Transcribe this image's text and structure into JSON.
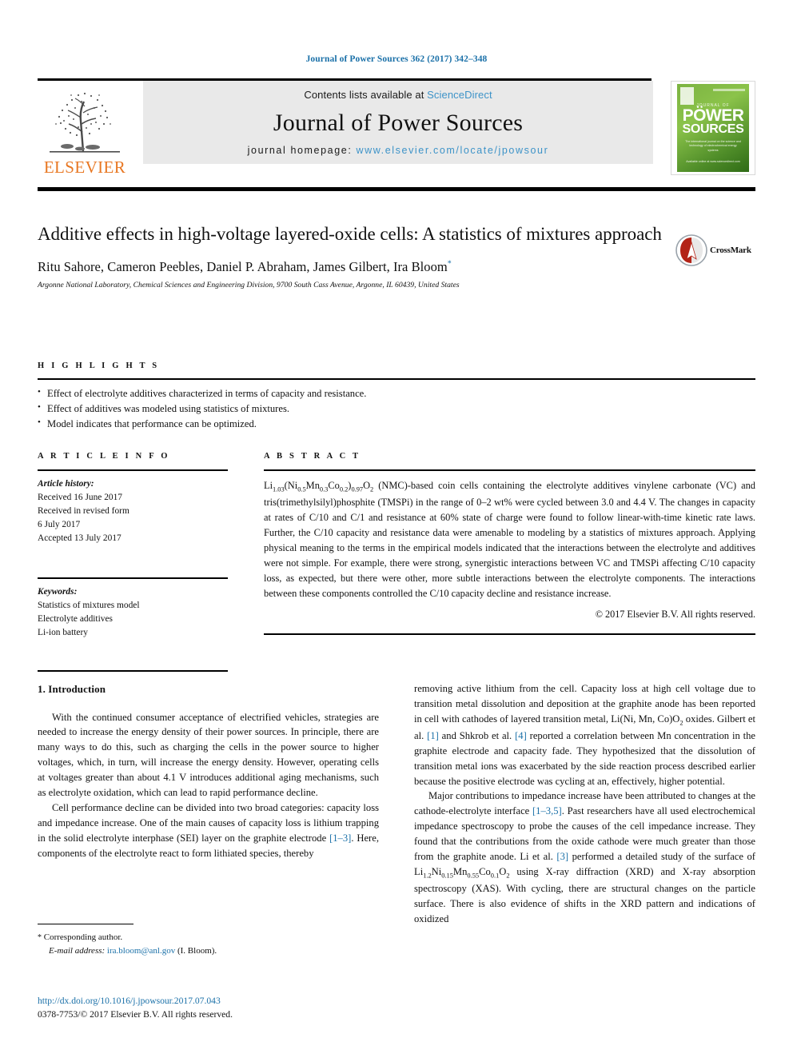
{
  "running_head": "Journal of Power Sources 362 (2017) 342–348",
  "masthead": {
    "contents_prefix": "Contents lists available at ",
    "sciencedirect": "ScienceDirect",
    "journal_name": "Journal of Power Sources",
    "homepage_prefix": "journal homepage: ",
    "homepage_url": "www.elsevier.com/locate/jpowsour",
    "publisher_wordmark": "ELSEVIER",
    "publisher_logo_icon": "elsevier-tree-icon",
    "cover": {
      "masthead_small": "JOURNAL OF",
      "title_line1": "PÖWER",
      "title_line2": "SOURCES",
      "blurb": "The international journal on the science and technology of electrochemical energy systems",
      "footer": "Available online at\nwww.sciencedirect.com"
    }
  },
  "article": {
    "title": "Additive effects in high-voltage layered-oxide cells: A statistics of mixtures approach",
    "crossmark_label": "CrossMark",
    "crossmark_icon": "crossmark-icon",
    "authors": "Ritu Sahore, Cameron Peebles, Daniel P. Abraham, James Gilbert, Ira Bloom",
    "author_marker": "*",
    "affiliation": "Argonne National Laboratory, Chemical Sciences and Engineering Division, 9700 South Cass Avenue, Argonne, IL 60439, United States"
  },
  "highlights": {
    "heading": "H I G H L I G H T S",
    "items": [
      "Effect of electrolyte additives characterized in terms of capacity and resistance.",
      "Effect of additives was modeled using statistics of mixtures.",
      "Model indicates that performance can be optimized."
    ]
  },
  "article_info": {
    "heading": "A R T I C L E  I N F O",
    "history_label": "Article history:",
    "history": [
      "Received 16 June 2017",
      "Received in revised form",
      "6 July 2017",
      "Accepted 13 July 2017"
    ],
    "keywords_label": "Keywords:",
    "keywords": [
      "Statistics of mixtures model",
      "Electrolyte additives",
      "Li-ion battery"
    ]
  },
  "abstract": {
    "heading": "A B S T R A C T",
    "formula_prefix": "Li",
    "formula_sub1": "1.03",
    "formula_mid1": "(Ni",
    "formula_sub2": "0.5",
    "formula_mid2": "Mn",
    "formula_sub3": "0.3",
    "formula_mid3": "Co",
    "formula_sub4": "0.2",
    "formula_mid4": ")",
    "formula_sub5": "0.97",
    "formula_mid5": "O",
    "formula_sub6": "2",
    "text": " (NMC)-based coin cells containing the electrolyte additives vinylene carbonate (VC) and tris(trimethylsilyl)phosphite (TMSPi) in the range of 0–2 wt% were cycled between 3.0 and 4.4 V. The changes in capacity at rates of C/10 and C/1 and resistance at 60% state of charge were found to follow linear-with-time kinetic rate laws. Further, the C/10 capacity and resistance data were amenable to modeling by a statistics of mixtures approach. Applying physical meaning to the terms in the empirical models indicated that the interactions between the electrolyte and additives were not simple. For example, there were strong, synergistic interactions between VC and TMSPi affecting C/10 capacity loss, as expected, but there were other, more subtle interactions between the electrolyte components. The interactions between these components controlled the C/10 capacity decline and resistance increase.",
    "copyright": "© 2017 Elsevier B.V. All rights reserved."
  },
  "body": {
    "section_heading": "1. Introduction",
    "left_p1": "With the continued consumer acceptance of electrified vehicles, strategies are needed to increase the energy density of their power sources. In principle, there are many ways to do this, such as charging the cells in the power source to higher voltages, which, in turn, will increase the energy density. However, operating cells at voltages greater than about 4.1 V introduces additional aging mechanisms, such as electrolyte oxidation, which can lead to rapid performance decline.",
    "left_p2_a": "Cell performance decline can be divided into two broad categories: capacity loss and impedance increase. One of the main causes of capacity loss is lithium trapping in the solid electrolyte interphase (SEI) layer on the graphite electrode ",
    "left_p2_ref": "[1–3]",
    "left_p2_b": ". Here, components of the electrolyte react to form lithiated species, thereby",
    "right_p1_a": "removing active lithium from the cell. Capacity loss at high cell voltage due to transition metal dissolution and deposition at the graphite anode has been reported in cell with cathodes of layered transition metal, Li(Ni, Mn, Co)O",
    "right_p1_sub": "2",
    "right_p1_b": " oxides. Gilbert et al. ",
    "right_p1_ref1": "[1]",
    "right_p1_c": " and Shkrob et al. ",
    "right_p1_ref2": "[4]",
    "right_p1_d": " reported a correlation between Mn concentration in the graphite electrode and capacity fade. They hypothesized that the dissolution of transition metal ions was exacerbated by the side reaction process described earlier because the positive electrode was cycling at an, effectively, higher potential.",
    "right_p2_a": "Major contributions to impedance increase have been attributed to changes at the cathode-electrolyte interface ",
    "right_p2_ref1": "[1–3,5]",
    "right_p2_b": ". Past researchers have all used electrochemical impedance spectroscopy to probe the causes of the cell impedance increase. They found that the contributions from the oxide cathode were much greater than those from the graphite anode. Li et al. ",
    "right_p2_ref2": "[3]",
    "right_p2_c": " performed a detailed study of the surface of Li",
    "right_p2_sub1": "1.2",
    "right_p2_d": "Ni",
    "right_p2_sub2": "0.15",
    "right_p2_e": "Mn",
    "right_p2_sub3": "0.55",
    "right_p2_f": "Co",
    "right_p2_sub4": "0.1",
    "right_p2_g": "O",
    "right_p2_sub5": "2",
    "right_p2_h": " using X-ray diffraction (XRD) and X-ray absorption spectroscopy (XAS). With cycling, there are structural changes on the particle surface. There is also evidence of shifts in the XRD pattern and indications of oxidized"
  },
  "footnote": {
    "star": "*",
    "corresponding": " Corresponding author.",
    "email_label": "E-mail address:",
    "email": "ira.bloom@anl.gov",
    "email_suffix": " (I. Bloom)."
  },
  "doi": {
    "url": "http://dx.doi.org/10.1016/j.jpowsour.2017.07.043",
    "issn_line": "0378-7753/© 2017 Elsevier B.V. All rights reserved."
  },
  "colors": {
    "link_blue": "#1a70a8",
    "sd_blue": "#3d93c8",
    "elsevier_orange": "#E87722",
    "cover_green": "#7cb342",
    "crossmark_red": "#b32317"
  }
}
